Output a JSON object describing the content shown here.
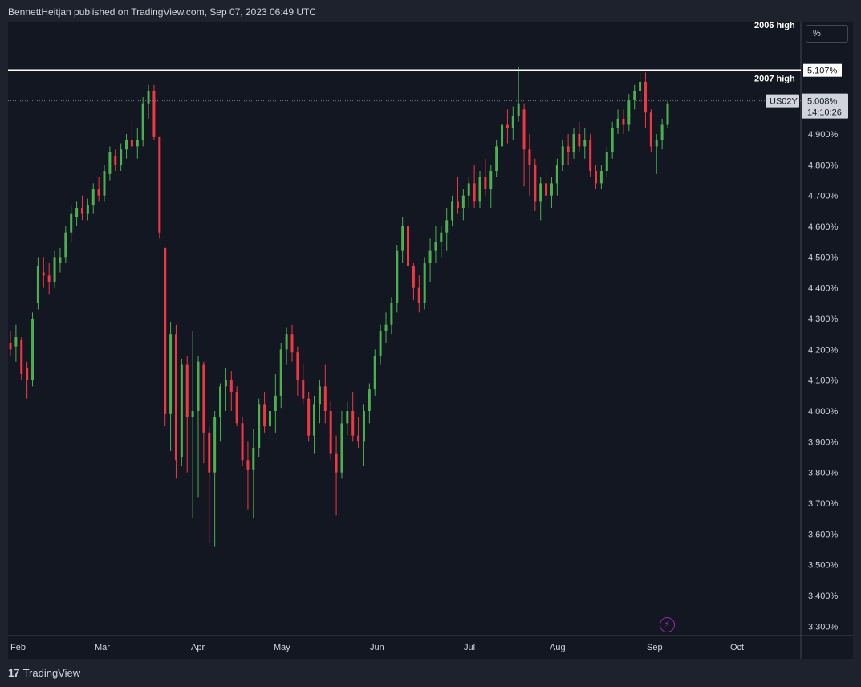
{
  "header": {
    "text": "BennettHeitjan published on TradingView.com, Sep 07, 2023 06:49 UTC"
  },
  "footer": {
    "brand": "TradingView",
    "mark": "17"
  },
  "controls": {
    "scale_mode": "%"
  },
  "colors": {
    "up": "#4caf50",
    "down": "#f23645",
    "bg": "#131722",
    "frame": "#1e222d",
    "text": "#d1d4dc",
    "level_line": "#ffffff",
    "icon_accent": "#9c27b0"
  },
  "chart_data": {
    "type": "candlestick",
    "symbol": "US02Y",
    "unit": "%",
    "y_range": [
      3.25,
      5.25
    ],
    "y_ticks": [
      "5.000%",
      "4.900%",
      "4.800%",
      "4.700%",
      "4.600%",
      "4.500%",
      "4.400%",
      "4.300%",
      "4.200%",
      "4.100%",
      "4.000%",
      "3.900%",
      "3.800%",
      "3.700%",
      "3.600%",
      "3.500%",
      "3.400%",
      "3.300%"
    ],
    "x_ticks": [
      "Feb",
      "Mar",
      "Apr",
      "May",
      "Jun",
      "Jul",
      "Aug",
      "Sep",
      "Oct"
    ],
    "last_price": {
      "label": "US02Y",
      "value": "5.008%",
      "countdown": "14:10:26"
    },
    "horizontal_levels": [
      {
        "label": "2007 high",
        "value": 5.107,
        "value_label": "5.107%"
      },
      {
        "label": "2006 high",
        "value": null
      }
    ],
    "candles": [
      [
        4.22,
        4.26,
        4.18,
        4.2
      ],
      [
        4.21,
        4.28,
        4.16,
        4.24
      ],
      [
        4.23,
        4.24,
        4.1,
        4.12
      ],
      [
        4.14,
        4.16,
        4.04,
        4.1
      ],
      [
        4.1,
        4.32,
        4.08,
        4.3
      ],
      [
        4.35,
        4.5,
        4.33,
        4.47
      ],
      [
        4.45,
        4.5,
        4.4,
        4.44
      ],
      [
        4.44,
        4.48,
        4.38,
        4.42
      ],
      [
        4.42,
        4.52,
        4.4,
        4.5
      ],
      [
        4.48,
        4.53,
        4.45,
        4.5
      ],
      [
        4.5,
        4.6,
        4.48,
        4.58
      ],
      [
        4.58,
        4.67,
        4.55,
        4.64
      ],
      [
        4.63,
        4.68,
        4.6,
        4.66
      ],
      [
        4.66,
        4.7,
        4.62,
        4.64
      ],
      [
        4.64,
        4.69,
        4.62,
        4.67
      ],
      [
        4.67,
        4.74,
        4.64,
        4.72
      ],
      [
        4.72,
        4.76,
        4.68,
        4.7
      ],
      [
        4.7,
        4.8,
        4.68,
        4.78
      ],
      [
        4.77,
        4.86,
        4.75,
        4.84
      ],
      [
        4.83,
        4.85,
        4.78,
        4.8
      ],
      [
        4.8,
        4.87,
        4.78,
        4.85
      ],
      [
        4.85,
        4.9,
        4.82,
        4.88
      ],
      [
        4.88,
        4.94,
        4.84,
        4.86
      ],
      [
        4.86,
        4.92,
        4.82,
        4.88
      ],
      [
        4.88,
        5.02,
        4.86,
        5.0
      ],
      [
        5.0,
        5.06,
        4.95,
        5.04
      ],
      [
        5.04,
        5.06,
        4.88,
        4.89
      ],
      [
        4.89,
        4.89,
        4.56,
        4.58
      ],
      [
        4.53,
        4.53,
        3.95,
        3.99
      ],
      [
        3.99,
        4.29,
        3.87,
        4.25
      ],
      [
        4.25,
        4.28,
        3.78,
        3.84
      ],
      [
        3.85,
        4.17,
        3.82,
        4.15
      ],
      [
        4.15,
        4.18,
        3.8,
        3.98
      ],
      [
        3.98,
        4.26,
        3.65,
        4.0
      ],
      [
        4.0,
        4.18,
        3.72,
        4.16
      ],
      [
        4.15,
        4.16,
        3.83,
        3.93
      ],
      [
        3.93,
        3.95,
        3.57,
        3.8
      ],
      [
        3.8,
        4.0,
        3.56,
        3.98
      ],
      [
        3.98,
        4.09,
        3.9,
        4.08
      ],
      [
        4.08,
        4.14,
        4.0,
        4.1
      ],
      [
        4.1,
        4.13,
        4.0,
        4.06
      ],
      [
        4.06,
        4.08,
        3.95,
        3.96
      ],
      [
        3.96,
        3.98,
        3.82,
        3.84
      ],
      [
        3.84,
        3.9,
        3.68,
        3.81
      ],
      [
        3.81,
        3.94,
        3.65,
        3.88
      ],
      [
        3.88,
        4.04,
        3.85,
        4.02
      ],
      [
        4.02,
        4.06,
        3.93,
        3.95
      ],
      [
        3.95,
        4.02,
        3.9,
        4.0
      ],
      [
        4.0,
        4.12,
        3.93,
        4.05
      ],
      [
        4.05,
        4.22,
        4.01,
        4.2
      ],
      [
        4.2,
        4.27,
        4.15,
        4.25
      ],
      [
        4.25,
        4.28,
        4.16,
        4.19
      ],
      [
        4.19,
        4.21,
        4.05,
        4.1
      ],
      [
        4.1,
        4.15,
        4.02,
        4.04
      ],
      [
        4.04,
        4.06,
        3.9,
        3.92
      ],
      [
        3.92,
        4.05,
        3.86,
        4.02
      ],
      [
        4.02,
        4.1,
        3.96,
        4.08
      ],
      [
        4.08,
        4.15,
        3.96,
        4.0
      ],
      [
        4.0,
        4.03,
        3.84,
        3.86
      ],
      [
        3.86,
        3.92,
        3.66,
        3.8
      ],
      [
        3.8,
        4.0,
        3.78,
        3.96
      ],
      [
        3.96,
        4.03,
        3.92,
        4.0
      ],
      [
        4.0,
        4.06,
        3.9,
        3.92
      ],
      [
        3.92,
        3.98,
        3.88,
        3.9
      ],
      [
        3.9,
        4.02,
        3.82,
        4.0
      ],
      [
        4.0,
        4.09,
        3.96,
        4.07
      ],
      [
        4.07,
        4.2,
        4.05,
        4.18
      ],
      [
        4.18,
        4.28,
        4.15,
        4.26
      ],
      [
        4.26,
        4.32,
        4.22,
        4.28
      ],
      [
        4.28,
        4.37,
        4.25,
        4.35
      ],
      [
        4.35,
        4.54,
        4.32,
        4.52
      ],
      [
        4.52,
        4.63,
        4.48,
        4.6
      ],
      [
        4.6,
        4.62,
        4.45,
        4.47
      ],
      [
        4.47,
        4.48,
        4.36,
        4.4
      ],
      [
        4.4,
        4.44,
        4.32,
        4.35
      ],
      [
        4.35,
        4.5,
        4.33,
        4.48
      ],
      [
        4.48,
        4.56,
        4.42,
        4.52
      ],
      [
        4.52,
        4.6,
        4.48,
        4.55
      ],
      [
        4.55,
        4.6,
        4.5,
        4.58
      ],
      [
        4.58,
        4.66,
        4.52,
        4.62
      ],
      [
        4.62,
        4.7,
        4.6,
        4.68
      ],
      [
        4.68,
        4.76,
        4.64,
        4.66
      ],
      [
        4.66,
        4.72,
        4.62,
        4.7
      ],
      [
        4.7,
        4.76,
        4.66,
        4.74
      ],
      [
        4.74,
        4.8,
        4.66,
        4.68
      ],
      [
        4.68,
        4.78,
        4.66,
        4.76
      ],
      [
        4.76,
        4.82,
        4.7,
        4.72
      ],
      [
        4.72,
        4.8,
        4.66,
        4.78
      ],
      [
        4.78,
        4.88,
        4.76,
        4.86
      ],
      [
        4.86,
        4.95,
        4.84,
        4.93
      ],
      [
        4.93,
        4.98,
        4.87,
        4.92
      ],
      [
        4.92,
        4.99,
        4.88,
        4.96
      ],
      [
        4.96,
        5.12,
        4.94,
        5.0
      ],
      [
        4.98,
        5.0,
        4.73,
        4.85
      ],
      [
        4.85,
        4.9,
        4.7,
        4.8
      ],
      [
        4.8,
        4.82,
        4.65,
        4.68
      ],
      [
        4.68,
        4.76,
        4.62,
        4.74
      ],
      [
        4.74,
        4.78,
        4.68,
        4.7
      ],
      [
        4.7,
        4.76,
        4.66,
        4.74
      ],
      [
        4.74,
        4.82,
        4.7,
        4.8
      ],
      [
        4.8,
        4.88,
        4.78,
        4.86
      ],
      [
        4.86,
        4.9,
        4.8,
        4.84
      ],
      [
        4.84,
        4.92,
        4.82,
        4.9
      ],
      [
        4.9,
        4.94,
        4.84,
        4.86
      ],
      [
        4.86,
        4.92,
        4.82,
        4.88
      ],
      [
        4.88,
        4.9,
        4.76,
        4.78
      ],
      [
        4.78,
        4.8,
        4.72,
        4.74
      ],
      [
        4.74,
        4.8,
        4.72,
        4.78
      ],
      [
        4.78,
        4.86,
        4.76,
        4.84
      ],
      [
        4.84,
        4.94,
        4.82,
        4.92
      ],
      [
        4.92,
        4.98,
        4.9,
        4.95
      ],
      [
        4.95,
        4.98,
        4.9,
        4.93
      ],
      [
        4.93,
        5.03,
        4.91,
        5.01
      ],
      [
        5.01,
        5.06,
        4.98,
        5.04
      ],
      [
        5.04,
        5.1,
        5.0,
        5.07
      ],
      [
        5.07,
        5.1,
        4.92,
        4.97
      ],
      [
        4.97,
        4.98,
        4.84,
        4.86
      ],
      [
        4.86,
        4.9,
        4.77,
        4.88
      ],
      [
        4.88,
        4.95,
        4.85,
        4.93
      ],
      [
        4.93,
        5.01,
        4.92,
        5.0
      ]
    ]
  }
}
